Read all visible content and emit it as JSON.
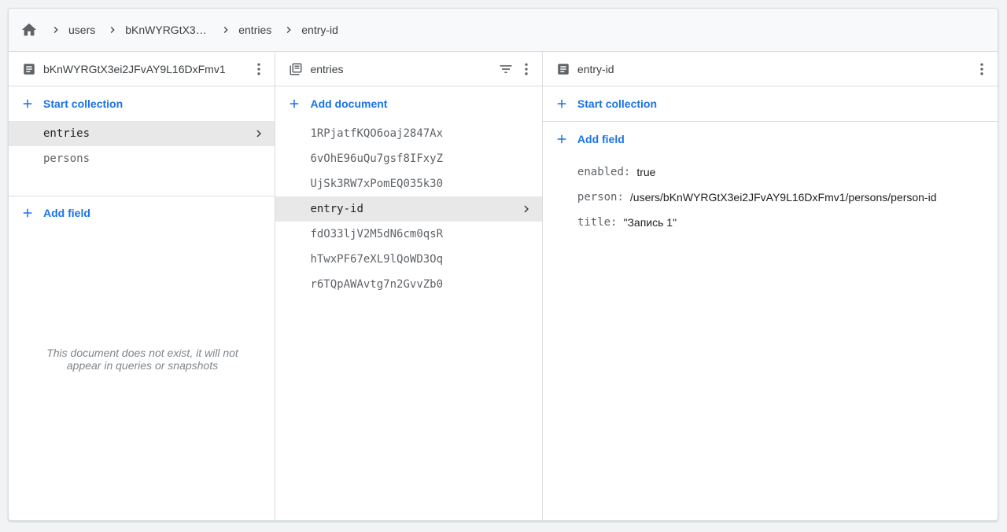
{
  "breadcrumb": {
    "home_icon": "home-icon",
    "items": [
      "users",
      "bKnWYRGtX3ei...",
      "entries",
      "entry-id"
    ]
  },
  "panel_document": {
    "title": "bKnWYRGtX3ei2JFvAY9L16DxFmv1",
    "start_collection_label": "Start collection",
    "collections": [
      "entries",
      "persons"
    ],
    "add_field_label": "Add field",
    "empty_message": "This document does not exist, it will not appear in queries or snapshots"
  },
  "panel_collection": {
    "title": "entries",
    "add_document_label": "Add document",
    "documents": [
      "1RPjatfKQO6oaj2847Ax",
      "6vOhE96uQu7gsf8IFxyZ",
      "UjSk3RW7xPomEQ035k30",
      "entry-id",
      "fdO33ljV2M5dN6cm0qsR",
      "hTwxPF67eXL9lQoWD3Oq",
      "r6TQpAWAvtg7n2GvvZb0"
    ],
    "selected_index": 3
  },
  "panel_entry": {
    "title": "entry-id",
    "start_collection_label": "Start collection",
    "add_field_label": "Add field",
    "fields": [
      {
        "key": "enabled:",
        "value": "true"
      },
      {
        "key": "person:",
        "value": "/users/bKnWYRGtX3ei2JFvAY9L16DxFmv1/persons/person-id"
      },
      {
        "key": "title:",
        "value": "\"Запись 1\""
      }
    ]
  },
  "colors": {
    "accent": "#1a73e8",
    "selected_row": "#e8e8e8",
    "border": "#dadce0",
    "icon": "#5f6368"
  }
}
